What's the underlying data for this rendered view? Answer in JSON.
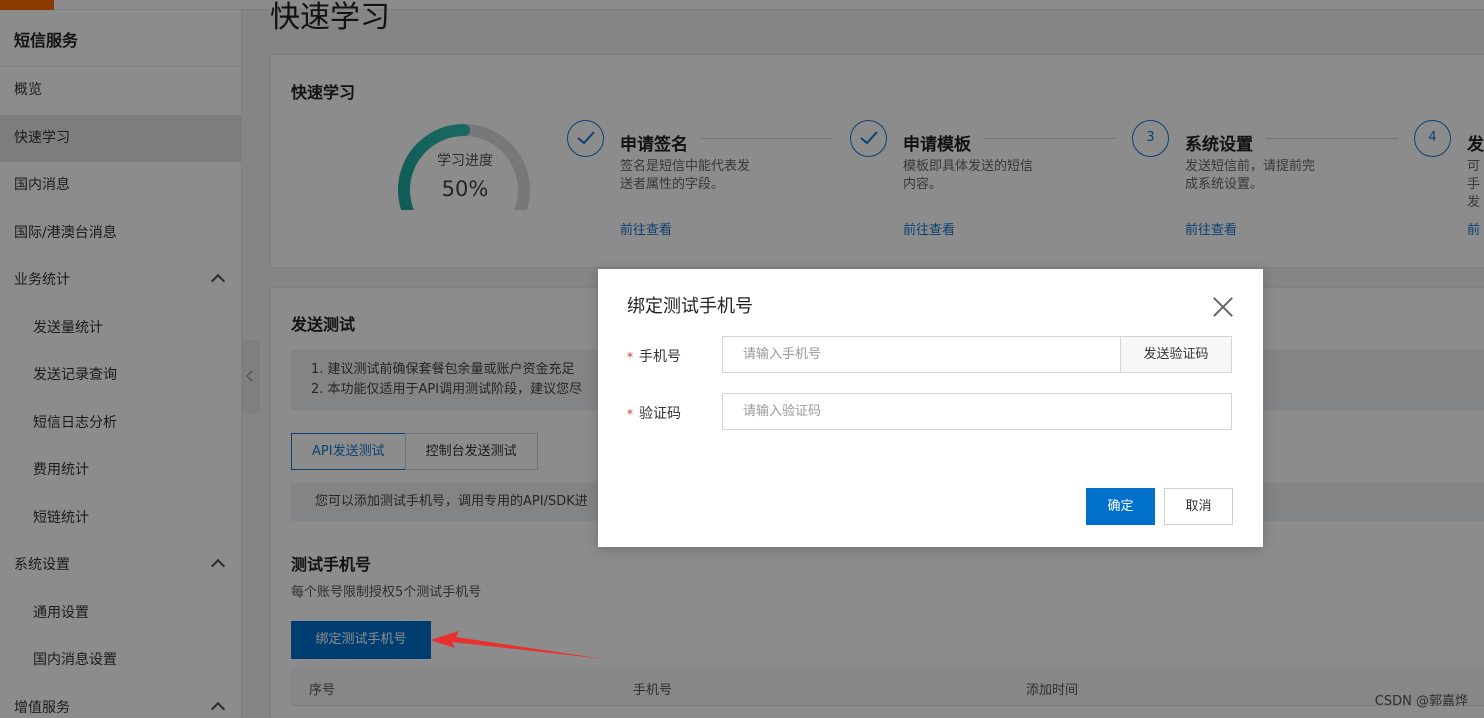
{
  "sidebar": {
    "title": "短信服务",
    "items": [
      {
        "label": "概览"
      },
      {
        "label": "快速学习"
      },
      {
        "label": "国内消息"
      },
      {
        "label": "国际/港澳台消息"
      },
      {
        "label": "业务统计"
      },
      {
        "label": "发送量统计"
      },
      {
        "label": "发送记录查询"
      },
      {
        "label": "短信日志分析"
      },
      {
        "label": "费用统计"
      },
      {
        "label": "短链统计"
      },
      {
        "label": "系统设置"
      },
      {
        "label": "通用设置"
      },
      {
        "label": "国内消息设置"
      },
      {
        "label": "增值服务"
      }
    ]
  },
  "page": {
    "title": "快速学习"
  },
  "learn": {
    "title": "快速学习",
    "progress_label": "学习进度",
    "progress_value": "50%",
    "progress_fraction": 0.5,
    "steps": [
      {
        "num": "",
        "done": true,
        "name": "申请签名",
        "desc": "签名是短信中能代表发送者属性的字段。",
        "link": "前往查看"
      },
      {
        "num": "",
        "done": true,
        "name": "申请模板",
        "desc": "模板即具体发送的短信内容。",
        "link": "前往查看"
      },
      {
        "num": "3",
        "done": false,
        "name": "系统设置",
        "desc": "发送短信前，请提前完成系统设置。",
        "link": "前往查看"
      },
      {
        "num": "4",
        "done": false,
        "name": "发",
        "desc": "可手发",
        "link": "前"
      }
    ]
  },
  "send_test": {
    "title": "发送测试",
    "notice_1": "1. 建议测试前确保套餐包余量或账户资金充足",
    "notice_2": "2. 本功能仅适用于API调用测试阶段，建议您尽",
    "tab_api": "API发送测试",
    "tab_console": "控制台发送测试",
    "tab_info": "您可以添加测试手机号，调用专用的API/SDK进",
    "phone_section_title": "测试手机号",
    "phone_section_desc": "每个账号限制授权5个测试手机号",
    "bind_button": "绑定测试手机号",
    "columns": [
      "序号",
      "手机号",
      "添加时间"
    ]
  },
  "modal": {
    "title": "绑定测试手机号",
    "phone_label": "手机号",
    "phone_placeholder": "请输入手机号",
    "send_code": "发送验证码",
    "code_label": "验证码",
    "code_placeholder": "请输入验证码",
    "ok": "确定",
    "cancel": "取消"
  },
  "watermark": "CSDN @郭嘉烨",
  "colors": {
    "primary": "#0070cc",
    "brand": "#ff6a00",
    "gauge_start": "#1aa39a",
    "gauge_end": "#2fc0b4",
    "required": "#d93026",
    "arrow": "#e8312f"
  }
}
